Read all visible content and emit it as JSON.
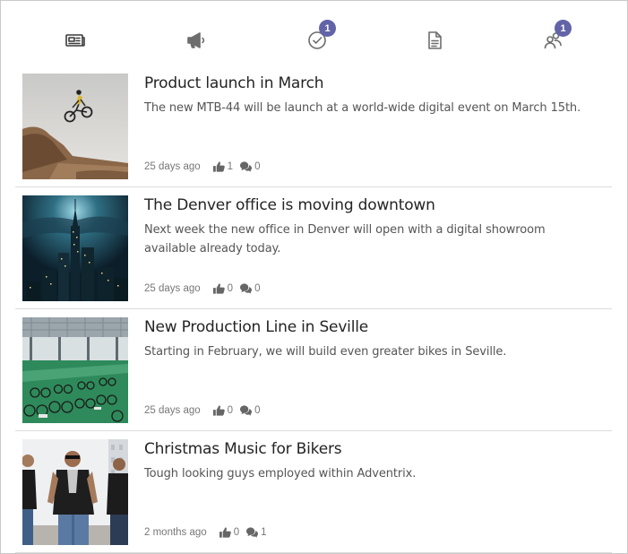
{
  "tabs": [
    {
      "name": "news",
      "icon": "newspaper-icon",
      "badge": ""
    },
    {
      "name": "announcements",
      "icon": "megaphone-icon",
      "badge": ""
    },
    {
      "name": "tasks",
      "icon": "check-circle-icon",
      "badge": "1"
    },
    {
      "name": "documents",
      "icon": "document-icon",
      "badge": ""
    },
    {
      "name": "people",
      "icon": "people-icon",
      "badge": "1"
    }
  ],
  "accent_color": "#6264a7",
  "feed": {
    "items": [
      {
        "title": "Product launch in March",
        "description": "The new MTB-44 will be launch at a world-wide digital event on March 15th.",
        "age": "25 days ago",
        "likes": "1",
        "comments": "0",
        "thumbnail": "mountain-bike-jump-photo"
      },
      {
        "title": "The Denver office is moving downtown",
        "description": "Next week the new office in Denver will open with a digital showroom available already today.",
        "age": "25 days ago",
        "likes": "0",
        "comments": "0",
        "thumbnail": "night-city-skyline-photo"
      },
      {
        "title": "New Production Line in Seville",
        "description": "Starting in February, we will build even greater bikes in Seville.",
        "age": "25 days ago",
        "likes": "0",
        "comments": "0",
        "thumbnail": "bike-factory-floor-photo"
      },
      {
        "title": "Christmas Music for Bikers",
        "description": "Tough looking guys employed within Adventrix.",
        "age": "2 months ago",
        "likes": "0",
        "comments": "1",
        "thumbnail": "bikers-group-photo"
      }
    ]
  }
}
